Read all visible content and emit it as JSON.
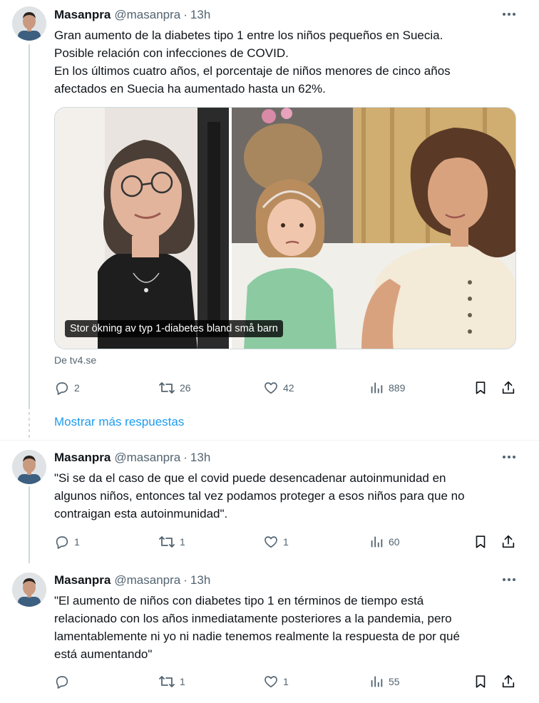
{
  "tweets": [
    {
      "author": "Masanpra",
      "handle": "@masanpra",
      "time": "13h",
      "lines": [
        "Gran aumento de la diabetes tipo 1 entre los niños pequeños en Suecia.",
        "Posible relación con infecciones de COVID.",
        "En los últimos cuatro años, el porcentaje de niños menores de cinco años",
        "afectados en Suecia ha aumentado hasta un 62%."
      ],
      "media_caption": "Stor ökning av typ 1-diabetes bland små barn",
      "source": "De tv4.se",
      "replies": "2",
      "retweets": "26",
      "likes": "42",
      "views": "889"
    },
    {
      "author": "Masanpra",
      "handle": "@masanpra",
      "time": "13h",
      "lines": [
        "\"Si se da el caso de que el covid puede desencadenar autoinmunidad en",
        "algunos niños, entonces tal vez podamos proteger a esos niños para que no",
        "contraigan esta autoinmunidad\"."
      ],
      "replies": "1",
      "retweets": "1",
      "likes": "1",
      "views": "60"
    },
    {
      "author": "Masanpra",
      "handle": "@masanpra",
      "time": "13h",
      "lines": [
        "\"El aumento de niños con diabetes tipo 1 en términos de tiempo está",
        "relacionado con los años inmediatamente posteriores a la pandemia, pero",
        "lamentablemente ni yo ni nadie tenemos realmente la respuesta de por qué",
        "está aumentando\""
      ],
      "replies": "",
      "retweets": "1",
      "likes": "1",
      "views": "55"
    }
  ],
  "show_more_label": "Mostrar más respuestas",
  "colors": {
    "accent": "#1d9bf0",
    "secondary_text": "#536471",
    "primary_text": "#0f1419"
  }
}
